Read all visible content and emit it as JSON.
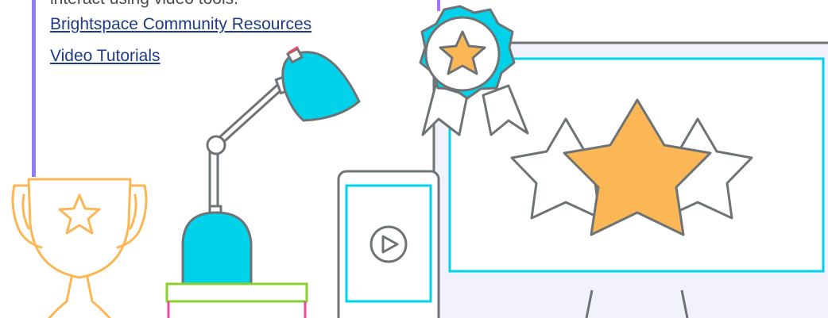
{
  "intro": {
    "partial_text": "interact using video tools."
  },
  "links": [
    {
      "label": "Brightspace Community Resources"
    },
    {
      "label": "Video Tutorials"
    }
  ],
  "illustration": {
    "icons": [
      "trophy-icon",
      "desk-lamp-icon",
      "award-ribbon-icon",
      "tablet-play-icon",
      "monitor-rating-icon"
    ],
    "colors": {
      "accent_cyan": "#00d2ea",
      "gold": "#fbb656",
      "outline": "#6e7376",
      "purple_bar": "#8b7cf7",
      "magenta": "#e84a9c",
      "green": "#8ad12f",
      "screen_bg": "#f1f2fb"
    }
  }
}
